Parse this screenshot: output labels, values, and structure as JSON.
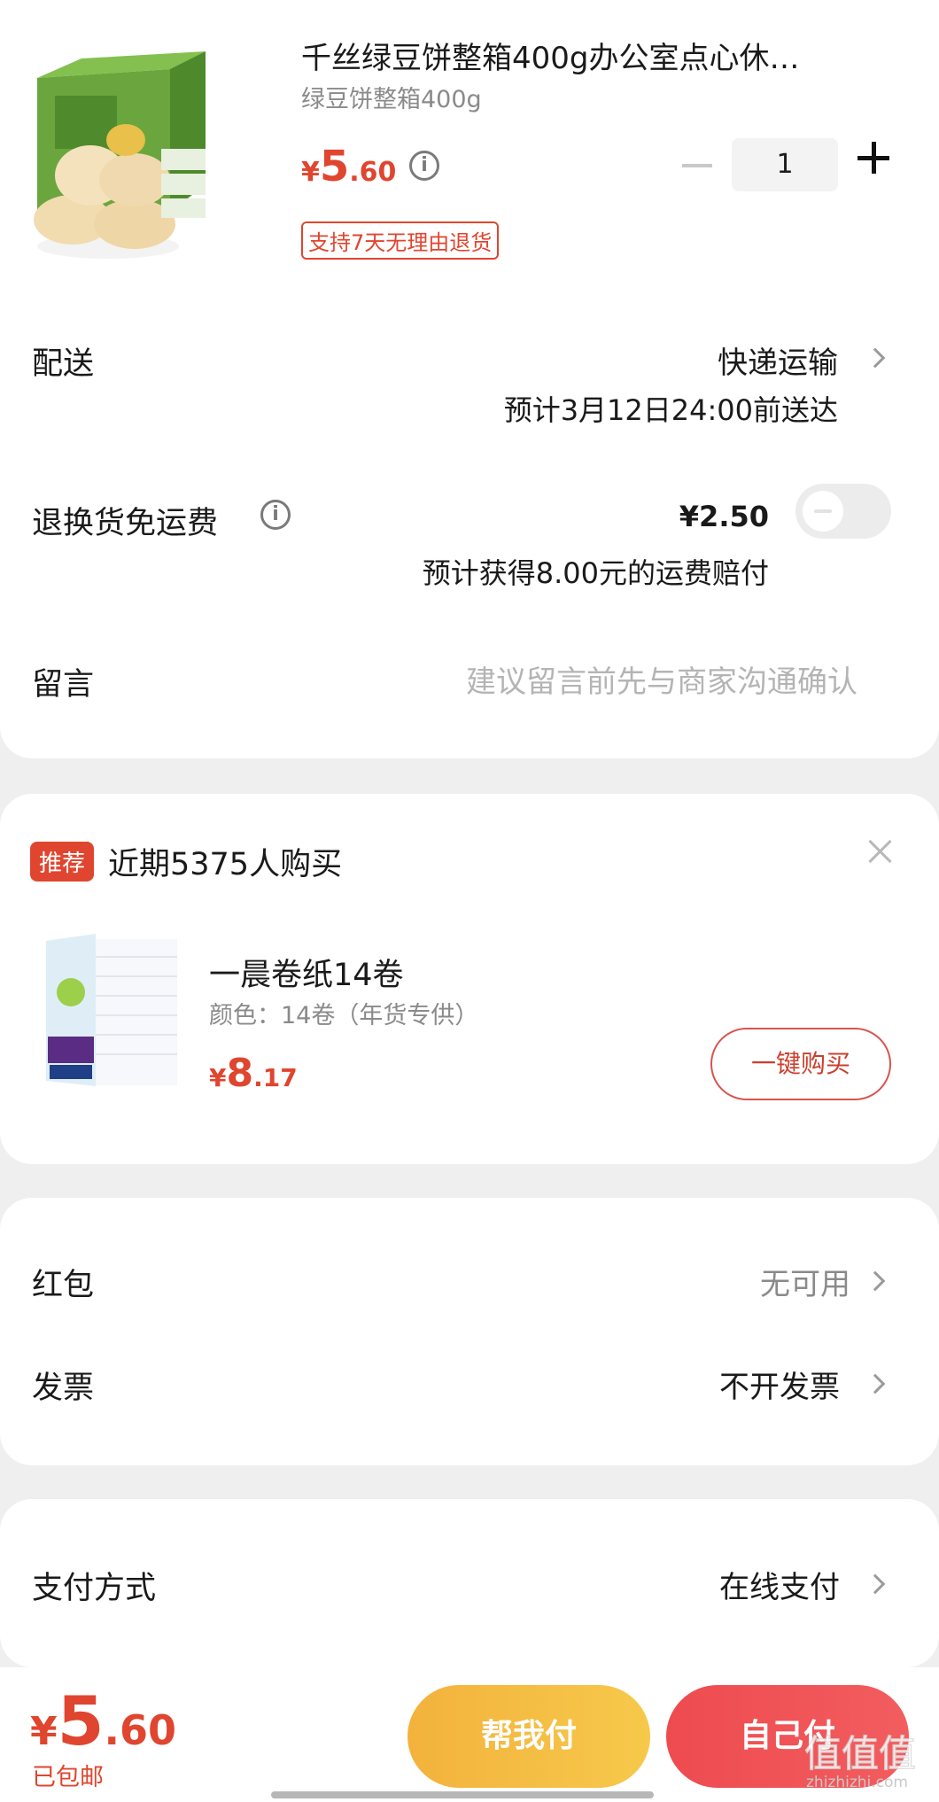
{
  "product": {
    "title": "千丝绿豆饼整箱400g办公室点心休…",
    "subtitle": "绿豆饼整箱400g",
    "price_symbol": "¥",
    "price_int": "5",
    "price_dec": ".60",
    "tag": "支持7天无理由退货",
    "quantity": "1",
    "info_glyph": "i"
  },
  "delivery": {
    "label": "配送",
    "method": "快递运输",
    "eta": "预计3月12日24:00前送达"
  },
  "return_insurance": {
    "label": "退换货免运费",
    "price": "¥2.50",
    "note": "预计获得8.00元的运费赔付",
    "enabled": false
  },
  "message": {
    "label": "留言",
    "placeholder": "建议留言前先与商家沟通确认"
  },
  "recommend": {
    "badge": "推荐",
    "title": "近期5375人购买",
    "item_name": "一晨卷纸14卷",
    "item_spec": "颜色：14卷（年货专供）",
    "price_symbol": "¥",
    "price_int": "8",
    "price_dec": ".17",
    "buy_label": "一键购买"
  },
  "options": {
    "red_packet_label": "红包",
    "red_packet_value": "无可用",
    "invoice_label": "发票",
    "invoice_value": "不开发票"
  },
  "payment": {
    "label": "支付方式",
    "value": "在线支付"
  },
  "footer": {
    "price_symbol": "¥",
    "price_int": "5",
    "price_dec": ".60",
    "shipping_note": "已包邮",
    "help_pay_label": "帮我付",
    "self_pay_label": "自己付",
    "watermark_text": "值值值",
    "watermark_url": "zhizhizhi.com"
  },
  "colors": {
    "accent": "#e0452f",
    "help_button": "#f3b23c",
    "self_button": "#ee4b4f"
  }
}
